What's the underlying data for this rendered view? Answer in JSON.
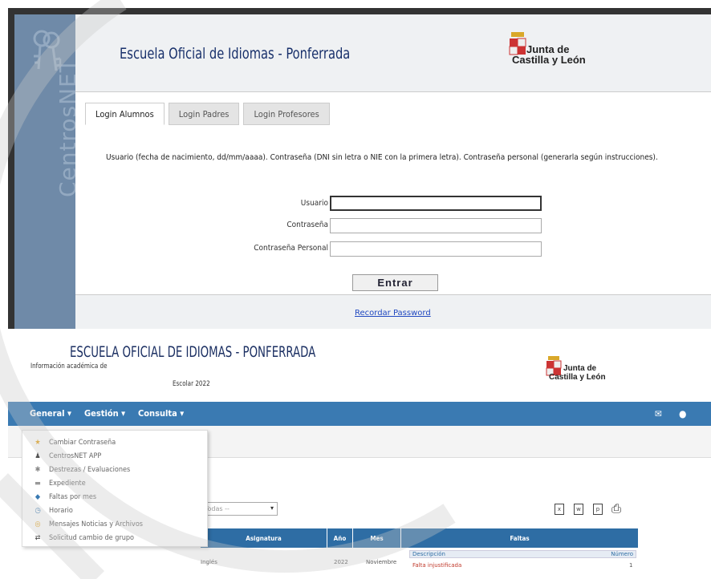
{
  "login": {
    "sidebar_brand": "CentrosNET",
    "school_title": "Escuela Oficial de Idiomas - Ponferrada",
    "logo": {
      "line1": "Junta de",
      "line2": "Castilla y León"
    },
    "tabs": [
      {
        "label": "Login Alumnos",
        "active": true
      },
      {
        "label": "Login Padres",
        "active": false
      },
      {
        "label": "Login Profesores",
        "active": false
      }
    ],
    "instructions": "Usuario (fecha de nacimiento, dd/mm/aaaa). Contraseña (DNI sin letra o NIE con la primera letra). Contraseña personal (generarla según instrucciones).",
    "fields": {
      "usuario_label": "Usuario",
      "contrasena_label": "Contraseña",
      "personal_label": "Contraseña Personal"
    },
    "submit_label": "Entrar",
    "recover_link": "Recordar Password"
  },
  "portal": {
    "title": "ESCUELA OFICIAL DE IDIOMAS - PONFERRADA",
    "info_label": "Información académica de",
    "escolar": "Escolar 2022",
    "logo": {
      "line1": "Junta de",
      "line2": "Castilla y León"
    },
    "nav": [
      "General",
      "Gestión",
      "Consulta"
    ],
    "menu_items": [
      {
        "label": "Cambiar Contraseña",
        "icon": "star-icon",
        "color": "#e3a21a"
      },
      {
        "label": "CentrosNET APP",
        "icon": "person-icon",
        "color": "#555555"
      },
      {
        "label": "Destrezas / Evaluaciones",
        "icon": "tools-icon",
        "color": "#888888"
      },
      {
        "label": "Expediente",
        "icon": "folder-icon",
        "color": "#999999"
      },
      {
        "label": "Faltas por mes",
        "icon": "calendar-icon",
        "color": "#3a7ab2"
      },
      {
        "label": "Horario",
        "icon": "clock-icon",
        "color": "#3a7ab2"
      },
      {
        "label": "Mensajes Noticias y Archivos",
        "icon": "mail-icon",
        "color": "#e3a21a"
      },
      {
        "label": "Solicitud cambio de grupo",
        "icon": "swap-icon",
        "color": "#333333"
      }
    ],
    "select_placeholder": "Todas --",
    "table": {
      "headers": [
        "Asignatura",
        "Año",
        "Mes",
        "Faltas"
      ],
      "row": {
        "asignatura": "Inglés",
        "anio": "2022",
        "mes": "Noviembre"
      },
      "sub_headers": [
        "Descripción",
        "Número"
      ],
      "sub_row": {
        "descripcion": "Falta injustificada",
        "numero": "1"
      }
    }
  },
  "colors": {
    "brand_blue": "#3a7ab2",
    "sidebar": "#6f8aa8",
    "title": "#18306b"
  }
}
